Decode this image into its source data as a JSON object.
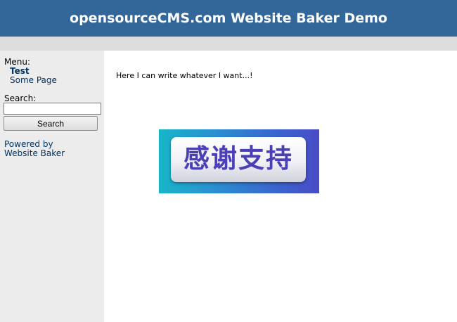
{
  "header": {
    "title": "opensourceCMS.com Website Baker Demo"
  },
  "sidebar": {
    "menu_heading": "Menu:",
    "items": [
      {
        "label": "Test",
        "active": true
      },
      {
        "label": "Some Page",
        "active": false
      }
    ],
    "search_label": "Search:",
    "search_value": "",
    "search_button": "Search",
    "powered_line1": "Powered by",
    "powered_line2": "Website Baker"
  },
  "main": {
    "text": "Here I can write whatever I want...!",
    "banner_text": "感谢支持"
  },
  "colors": {
    "header_bg": "#336699",
    "sidebar_bg": "#ececec",
    "link": "#003366"
  }
}
